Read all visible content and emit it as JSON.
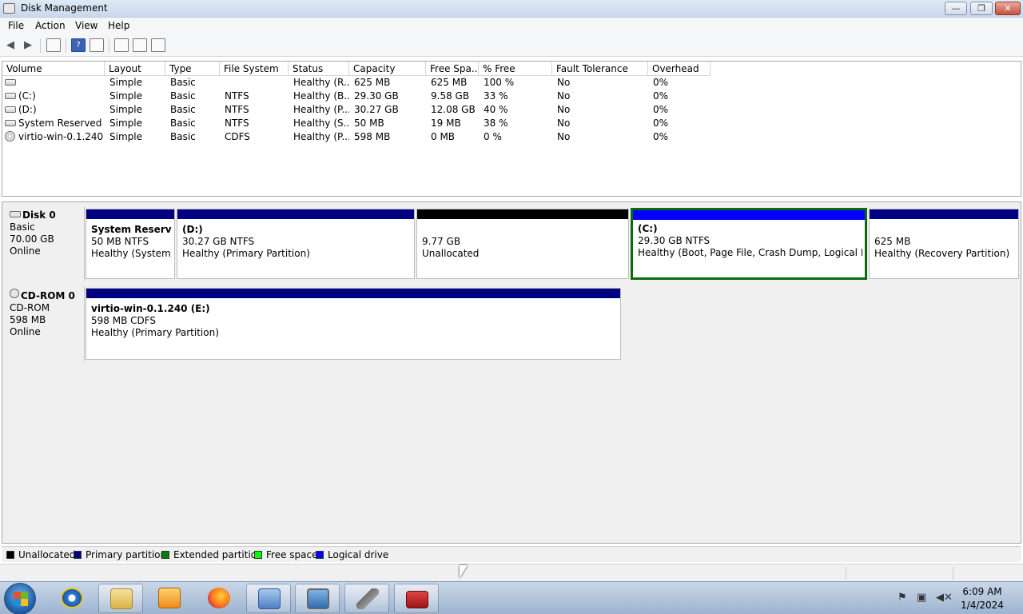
{
  "window": {
    "title": "Disk Management",
    "min": "—",
    "max": "❐",
    "close": "✕"
  },
  "menu": [
    "File",
    "Action",
    "View",
    "Help"
  ],
  "toolbar": {
    "back": "◀",
    "forward": "▶",
    "help": "?"
  },
  "volumes": {
    "columns": [
      "Volume",
      "Layout",
      "Type",
      "File System",
      "Status",
      "Capacity",
      "Free Spa...",
      "% Free",
      "Fault Tolerance",
      "Overhead"
    ],
    "rows": [
      {
        "volume": "",
        "layout": "Simple",
        "type": "Basic",
        "fs": "",
        "status": "Healthy (R...",
        "capacity": "625 MB",
        "free": "625 MB",
        "pct": "100 %",
        "fault": "No",
        "overhead": "0%"
      },
      {
        "volume": "(C:)",
        "layout": "Simple",
        "type": "Basic",
        "fs": "NTFS",
        "status": "Healthy (B...",
        "capacity": "29.30 GB",
        "free": "9.58 GB",
        "pct": "33 %",
        "fault": "No",
        "overhead": "0%"
      },
      {
        "volume": "(D:)",
        "layout": "Simple",
        "type": "Basic",
        "fs": "NTFS",
        "status": "Healthy (P...",
        "capacity": "30.27 GB",
        "free": "12.08 GB",
        "pct": "40 %",
        "fault": "No",
        "overhead": "0%"
      },
      {
        "volume": "System Reserved",
        "layout": "Simple",
        "type": "Basic",
        "fs": "NTFS",
        "status": "Healthy (S...",
        "capacity": "50 MB",
        "free": "19 MB",
        "pct": "38 %",
        "fault": "No",
        "overhead": "0%"
      },
      {
        "volume": "virtio-win-0.1.240 ...",
        "layout": "Simple",
        "type": "Basic",
        "fs": "CDFS",
        "status": "Healthy (P...",
        "capacity": "598 MB",
        "free": "0 MB",
        "pct": "0 %",
        "fault": "No",
        "overhead": "0%"
      }
    ]
  },
  "disk0": {
    "name": "Disk 0",
    "kind": "Basic",
    "size": "70.00 GB",
    "state": "Online",
    "partitions": [
      {
        "title": "System Reserved",
        "size": "50 MB NTFS",
        "status": "Healthy (System, A",
        "bar": "#000080"
      },
      {
        "title": "(D:)",
        "size": "30.27 GB NTFS",
        "status": "Healthy (Primary Partition)",
        "bar": "#000080"
      },
      {
        "title": "",
        "size": "9.77 GB",
        "status": "Unallocated",
        "bar": "#000000"
      },
      {
        "title": "(C:)",
        "size": "29.30 GB NTFS",
        "status": "Healthy (Boot, Page File, Crash Dump, Logical Drive)",
        "bar": "#0000ff"
      },
      {
        "title": "",
        "size": "625 MB",
        "status": "Healthy (Recovery Partition)",
        "bar": "#000080"
      }
    ]
  },
  "cdrom0": {
    "name": "CD-ROM 0",
    "kind": "CD-ROM",
    "size": "598 MB",
    "state": "Online",
    "partition": {
      "title": "virtio-win-0.1.240  (E:)",
      "size": "598 MB CDFS",
      "status": "Healthy (Primary Partition)",
      "bar": "#000080"
    }
  },
  "legend": [
    {
      "label": "Unallocated",
      "color": "#000000"
    },
    {
      "label": "Primary partition",
      "color": "#000080"
    },
    {
      "label": "Extended partition",
      "color": "#008000"
    },
    {
      "label": "Free space",
      "color": "#00ff00"
    },
    {
      "label": "Logical drive",
      "color": "#0000ff"
    }
  ],
  "taskbar": {
    "time": "6:09 AM",
    "date": "1/4/2024"
  }
}
